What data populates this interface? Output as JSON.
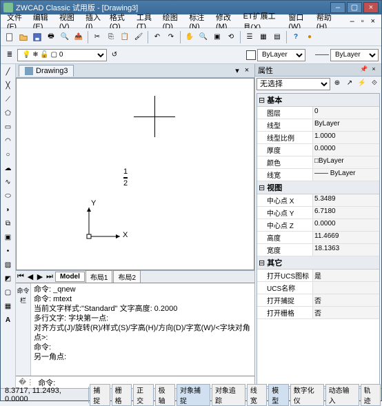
{
  "window": {
    "title": "ZWCAD Classic 试用版 - [Drawing3]"
  },
  "menu": [
    "文件(F)",
    "编辑(E)",
    "视图(V)",
    "插入(I)",
    "格式(O)",
    "工具(T)",
    "绘图(D)",
    "标注(N)",
    "修改(M)",
    "ET扩展工具(X)",
    "窗口(W)",
    "帮助(H)"
  ],
  "layerCombo": {
    "bylayer1": "ByLayer",
    "bylayer2": "ByLayer"
  },
  "doc": {
    "tab": "Drawing3"
  },
  "canvas": {
    "fraction_num": "1",
    "fraction_den": "2",
    "axis_x": "X",
    "axis_y": "Y"
  },
  "modelTabs": {
    "model": "Model",
    "layout1": "布局1",
    "layout2": "布局2"
  },
  "cmd": {
    "l1": "命令: _qnew",
    "l2": "命令: mtext",
    "l3": "当前文字样式:\"Standard\" 文字高度: 0.2000",
    "l4": "多行文字: 字块第一点:",
    "l5": "对齐方式(J)/旋转(R)/样式(S)/字高(H)/方向(D)/字宽(W)/<字块对角点>:",
    "l6": "命令:",
    "l7": "另一角点:",
    "prompt": "命令:",
    "sidelabel": "命令栏"
  },
  "props": {
    "title": "属性",
    "noSelect": "无选择",
    "groups": {
      "basic": "基本",
      "view": "视图",
      "other": "其它"
    },
    "basic": {
      "图层": "0",
      "线型": "ByLayer",
      "线型比例": "1.0000",
      "厚度": "0.0000",
      "颜色": "□ByLayer",
      "线宽": "—— ByLayer"
    },
    "view": {
      "中心点 X": "5.3489",
      "中心点 Y": "6.7180",
      "中心点 Z": "0.0000",
      "高度": "11.4669",
      "宽度": "18.1363"
    },
    "other": {
      "打开UCS图标": "是",
      "UCS名称": "",
      "打开捕捉": "否",
      "打开栅格": "否"
    }
  },
  "status": {
    "coords": "8.3717, 11.2493, 0.0000",
    "buttons": [
      "捕捉",
      "栅格",
      "正交",
      "极轴",
      "对象捕捉",
      "对象追踪",
      "线宽",
      "模型",
      "数字化仪",
      "动态输入",
      "轨迹"
    ]
  }
}
